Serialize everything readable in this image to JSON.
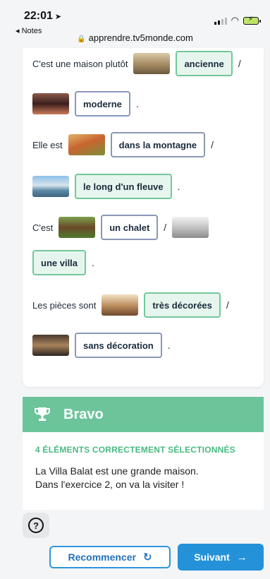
{
  "status_bar": {
    "time": "22:01",
    "back_label": "◂ Notes",
    "url": "apprendre.tv5monde.com"
  },
  "exercise": {
    "rows": [
      {
        "text": "C'est une maison plutôt",
        "choice": "ancienne",
        "selected": true,
        "after": "/"
      },
      {
        "choice": "moderne",
        "selected": false,
        "after": "."
      },
      {
        "text": "Elle est",
        "choice": "dans la montagne",
        "selected": false,
        "after": "/"
      },
      {
        "choice": "le long d'un fleuve",
        "selected": true,
        "after": "."
      },
      {
        "text": "C'est",
        "choice": "un chalet",
        "selected": false,
        "after": "/"
      },
      {
        "choice": "une villa",
        "selected": true,
        "after": "."
      },
      {
        "text": "Les pièces sont",
        "choice": "très décorées",
        "selected": true,
        "after": "/"
      },
      {
        "choice": "sans décoration",
        "selected": false,
        "after": "."
      }
    ]
  },
  "result": {
    "title": "Bravo",
    "subtitle": "4 ÉLÉMENTS CORRECTEMENT SÉLECTIONNÉS",
    "line1": "La Villa Balat est une grande maison.",
    "line2": "Dans l'exercice 2, on va la visiter !"
  },
  "footer": {
    "help_label": "?",
    "reset_label": "Recommencer",
    "next_label": "Suivant"
  },
  "colors": {
    "selected_border": "#73c79a",
    "unselected_border": "#8a97b6",
    "accent_green": "#6cc49b",
    "accent_blue": "#2491d8"
  }
}
